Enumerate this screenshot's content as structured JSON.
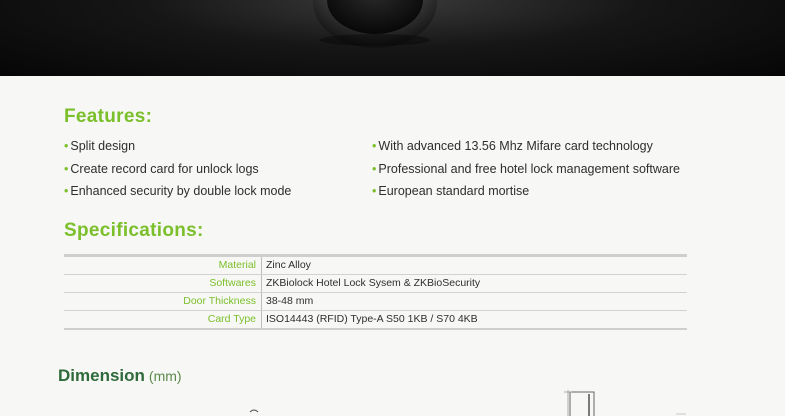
{
  "features": {
    "title": "Features:",
    "left_items": [
      "Split design",
      "Create record card for unlock logs",
      "Enhanced security by double lock mode"
    ],
    "right_items": [
      "With advanced 13.56 Mhz Mifare card technology",
      "Professional and free hotel lock management software",
      "European standard mortise"
    ],
    "bullet": "•"
  },
  "specifications": {
    "title": "Specifications:",
    "rows": [
      {
        "key": "Material",
        "value": "Zinc Alloy"
      },
      {
        "key": "Softwares",
        "value": "ZKBiolock Hotel Lock Sysem & ZKBioSecurity"
      },
      {
        "key": "Door Thickness",
        "value": "38-48 mm"
      },
      {
        "key": "Card Type",
        "value": "ISO14443 (RFID) Type-A S50 1KB / S70 4KB"
      }
    ]
  },
  "dimension": {
    "title": "Dimension",
    "unit": "(mm)"
  },
  "colors": {
    "accent_green": "#7bbf2a",
    "dimension_green": "#2f6a3a",
    "banner_dark": "#0a0a0a"
  }
}
